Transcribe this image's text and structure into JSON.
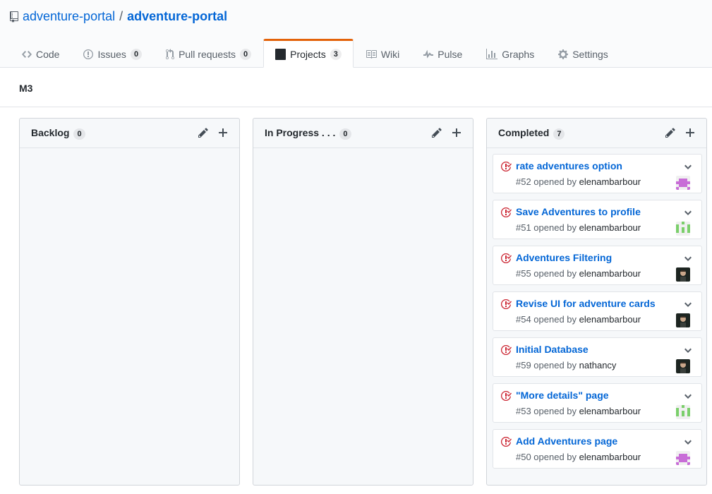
{
  "repo": {
    "owner": "adventure-portal",
    "separator": "/",
    "name": "adventure-portal"
  },
  "tabs": [
    {
      "label": "Code",
      "icon": "code-icon"
    },
    {
      "label": "Issues",
      "count": "0",
      "icon": "issue-opened-icon"
    },
    {
      "label": "Pull requests",
      "count": "0",
      "icon": "git-pull-request-icon"
    },
    {
      "label": "Projects",
      "count": "3",
      "icon": "project-icon",
      "selected": true
    },
    {
      "label": "Wiki",
      "icon": "book-icon"
    },
    {
      "label": "Pulse",
      "icon": "pulse-icon"
    },
    {
      "label": "Graphs",
      "icon": "graph-icon"
    },
    {
      "label": "Settings",
      "icon": "gear-icon"
    }
  ],
  "project": {
    "name": "M3"
  },
  "columns": [
    {
      "name": "Backlog",
      "count": "0",
      "cards": []
    },
    {
      "name": "In Progress . . .",
      "count": "0",
      "cards": []
    },
    {
      "name": "Completed",
      "count": "7",
      "cards": [
        {
          "title": "rate adventures option",
          "meta": "#52 opened by",
          "author": "elenambarbour",
          "avatar": "purple-identicon"
        },
        {
          "title": "Save Adventures to profile",
          "meta": "#51 opened by",
          "author": "elenambarbour",
          "avatar": "green-identicon"
        },
        {
          "title": "Adventures Filtering",
          "meta": "#55 opened by",
          "author": "elenambarbour",
          "avatar": "photo-avatar"
        },
        {
          "title": "Revise UI for adventure cards",
          "meta": "#54 opened by",
          "author": "elenambarbour",
          "avatar": "photo-avatar"
        },
        {
          "title": "Initial Database",
          "meta": "#59 opened by",
          "author": "nathancy",
          "avatar": "photo-avatar"
        },
        {
          "title": "\"More details\" page",
          "meta": "#53 opened by",
          "author": "elenambarbour",
          "avatar": "green-identicon"
        },
        {
          "title": "Add Adventures page",
          "meta": "#50 opened by",
          "author": "elenambarbour",
          "avatar": "purple-identicon"
        }
      ]
    }
  ],
  "colors": {
    "link": "#0366d6",
    "closed_issue": "#cb2431",
    "tab_accent": "#e36209"
  }
}
